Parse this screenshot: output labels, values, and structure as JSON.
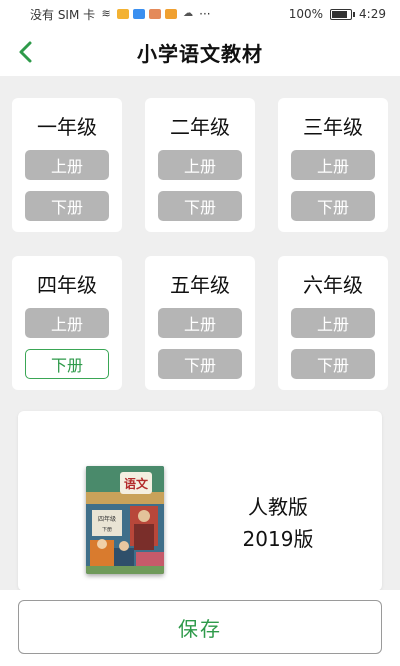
{
  "status_bar": {
    "carrier": "没有 SIM 卡",
    "battery": "100%",
    "battery_level": 1.0,
    "time": "4:29",
    "more": "···"
  },
  "header": {
    "title": "小学语文教材",
    "back_icon": "chevron-left-icon"
  },
  "grades": [
    {
      "name": "一年级",
      "volumes": [
        {
          "label": "上册",
          "selected": false
        },
        {
          "label": "下册",
          "selected": false
        }
      ]
    },
    {
      "name": "二年级",
      "volumes": [
        {
          "label": "上册",
          "selected": false
        },
        {
          "label": "下册",
          "selected": false
        }
      ]
    },
    {
      "name": "三年级",
      "volumes": [
        {
          "label": "上册",
          "selected": false
        },
        {
          "label": "下册",
          "selected": false
        }
      ]
    },
    {
      "name": "四年级",
      "volumes": [
        {
          "label": "上册",
          "selected": false
        },
        {
          "label": "下册",
          "selected": true
        }
      ]
    },
    {
      "name": "五年级",
      "volumes": [
        {
          "label": "上册",
          "selected": false
        },
        {
          "label": "下册",
          "selected": false
        }
      ]
    },
    {
      "name": "六年级",
      "volumes": [
        {
          "label": "上册",
          "selected": false
        },
        {
          "label": "下册",
          "selected": false
        }
      ]
    }
  ],
  "book": {
    "cover_title": "语文",
    "cover_grade": "四年级",
    "cover_volume": "下册",
    "edition": "人教版",
    "version": "2019版"
  },
  "footer": {
    "save_label": "保存"
  },
  "colors": {
    "accent": "#2e9a4a",
    "disabled_button": "#b5b5b5",
    "background": "#efefef"
  }
}
